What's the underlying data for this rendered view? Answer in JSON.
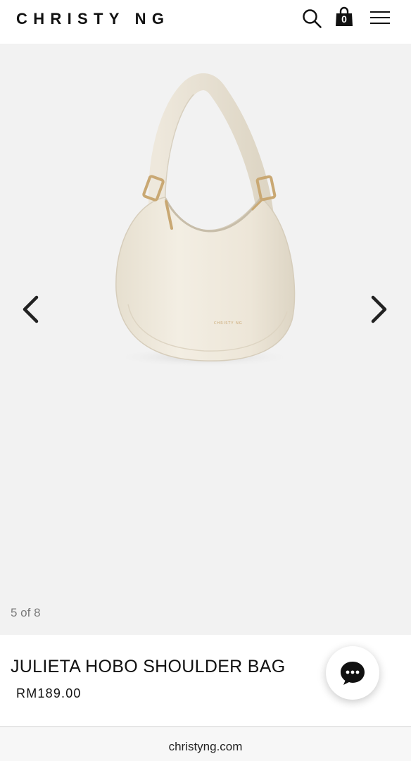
{
  "header": {
    "logo": "CHRISTY NG",
    "cart_count": "0",
    "icons": [
      "search-icon",
      "shopping-bag-icon",
      "hamburger-menu-icon"
    ]
  },
  "gallery": {
    "counter": "5 of 8",
    "image_brand_stamp": "CHRISTY NG",
    "prev_icon": "chevron-left-icon",
    "next_icon": "chevron-right-icon"
  },
  "product": {
    "title": "JULIETA HOBO SHOULDER BAG",
    "price": "RM189.00"
  },
  "chat": {
    "icon": "chat-bubble-icon"
  },
  "browser": {
    "url": "christyng.com"
  },
  "colors": {
    "gallery_bg": "#f2f2f2",
    "bag_cream": "#ede6d8",
    "hardware_gold": "#c9a873",
    "text": "#111111",
    "counter_text": "#7a7a7a"
  }
}
